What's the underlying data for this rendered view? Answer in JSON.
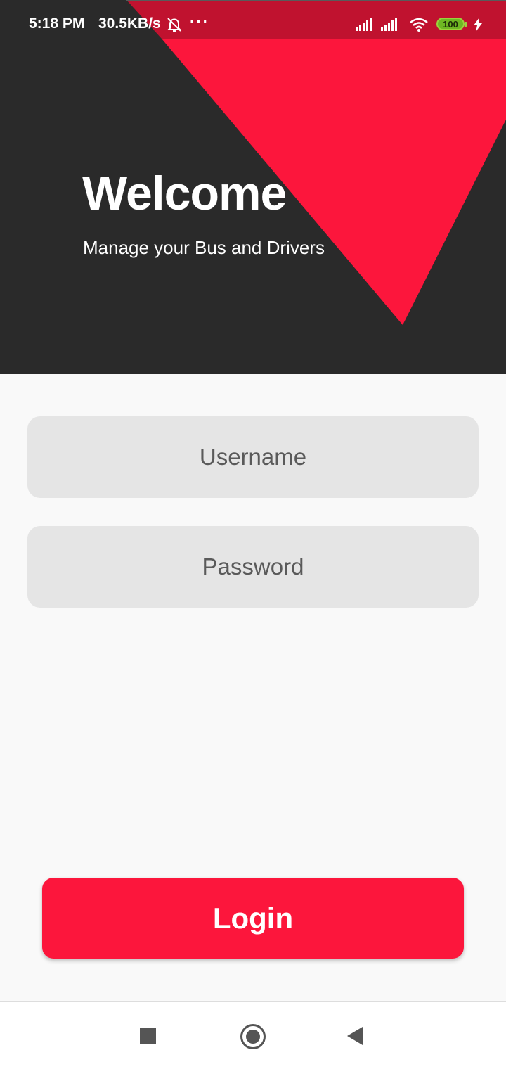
{
  "status_bar": {
    "time": "5:18 PM",
    "network_speed": "30.5KB/s",
    "more_indicator": "···",
    "battery_level": "100",
    "icons": [
      "mute-bell-icon",
      "signal-icon",
      "signal-icon",
      "wifi-icon",
      "battery-icon",
      "charging-icon"
    ]
  },
  "header": {
    "title": "Welcome",
    "subtitle": "Manage your Bus and Drivers",
    "background_color": "#2a2a2a",
    "accent_color": "#fc163c"
  },
  "form": {
    "username_placeholder": "Username",
    "username_value": "",
    "password_placeholder": "Password",
    "password_value": ""
  },
  "login_button": {
    "label": "Login",
    "color": "#fc163c"
  },
  "nav_bar": {
    "icons": [
      "recents-square-icon",
      "home-circle-icon",
      "back-triangle-icon"
    ]
  }
}
